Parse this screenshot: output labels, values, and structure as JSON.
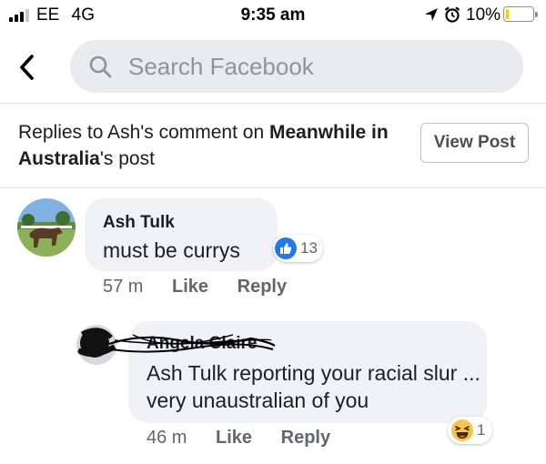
{
  "status_bar": {
    "carrier": "EE",
    "network": "4G",
    "time": "9:35 am",
    "battery_percent": "10%",
    "battery_level": 0.1,
    "icons": [
      "signal-bars-icon",
      "location-arrow-icon",
      "alarm-clock-icon",
      "battery-icon"
    ]
  },
  "search": {
    "placeholder": "Search Facebook"
  },
  "context": {
    "prefix": "Replies to Ash's comment on ",
    "page_name": "Meanwhile in Australia",
    "suffix": "'s post",
    "view_post_label": "View Post"
  },
  "comments": [
    {
      "author": "Ash Tulk",
      "text": "must be currys",
      "reaction_type": "like",
      "reaction_count": "13",
      "time": "57 m",
      "like_label": "Like",
      "reply_label": "Reply"
    },
    {
      "author": "Angela Claire",
      "text": "Ash Tulk reporting your racial slur ... very unaustralian of you",
      "reaction_type": "haha",
      "reaction_count": "1",
      "time": "46 m",
      "like_label": "Like",
      "reply_label": "Reply"
    }
  ],
  "colors": {
    "like_blue": "#2078f4",
    "bubble_bg": "#f0f2f5",
    "muted_text": "#606770",
    "haha_yellow": "#f7c74a"
  }
}
